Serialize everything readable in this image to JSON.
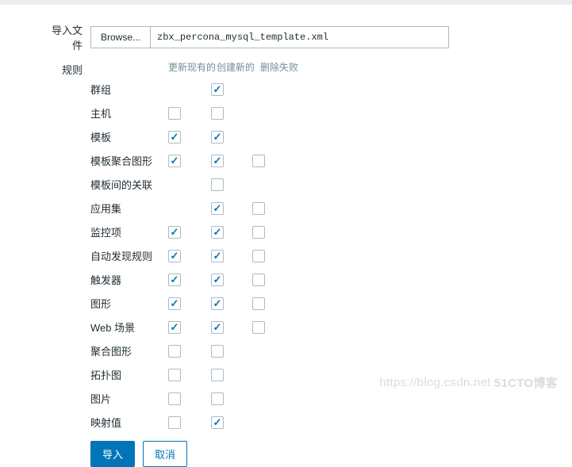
{
  "labels": {
    "importFile": "导入文件",
    "rules": "规则",
    "browse": "Browse...",
    "fileName": "zbx_percona_mysql_template.xml"
  },
  "headers": {
    "updateExisting": "更新现有的",
    "createNew": "创建新的",
    "deleteMissing": "删除失败"
  },
  "rules": [
    {
      "label": "群组",
      "update": null,
      "create": true,
      "delete": null
    },
    {
      "label": "主机",
      "update": false,
      "create": false,
      "delete": null
    },
    {
      "label": "模板",
      "update": true,
      "create": true,
      "delete": null
    },
    {
      "label": "模板聚合图形",
      "update": true,
      "create": true,
      "delete": false
    },
    {
      "label": "模板间的关联",
      "update": null,
      "create": false,
      "delete": null
    },
    {
      "label": "应用集",
      "update": null,
      "create": true,
      "delete": false
    },
    {
      "label": "监控项",
      "update": true,
      "create": true,
      "delete": false
    },
    {
      "label": "自动发现规则",
      "update": true,
      "create": true,
      "delete": false
    },
    {
      "label": "触发器",
      "update": true,
      "create": true,
      "delete": false
    },
    {
      "label": "图形",
      "update": true,
      "create": true,
      "delete": false
    },
    {
      "label": "Web 场景",
      "update": true,
      "create": true,
      "delete": false
    },
    {
      "label": "聚合图形",
      "update": false,
      "create": false,
      "delete": null
    },
    {
      "label": "拓扑图",
      "update": false,
      "create": false,
      "delete": null
    },
    {
      "label": "图片",
      "update": false,
      "create": false,
      "delete": null
    },
    {
      "label": "映射值",
      "update": false,
      "create": true,
      "delete": null
    }
  ],
  "buttons": {
    "import": "导入",
    "cancel": "取消"
  },
  "watermark": {
    "url": "https://blog.csdn.net",
    "brand": "51CTO博客"
  }
}
